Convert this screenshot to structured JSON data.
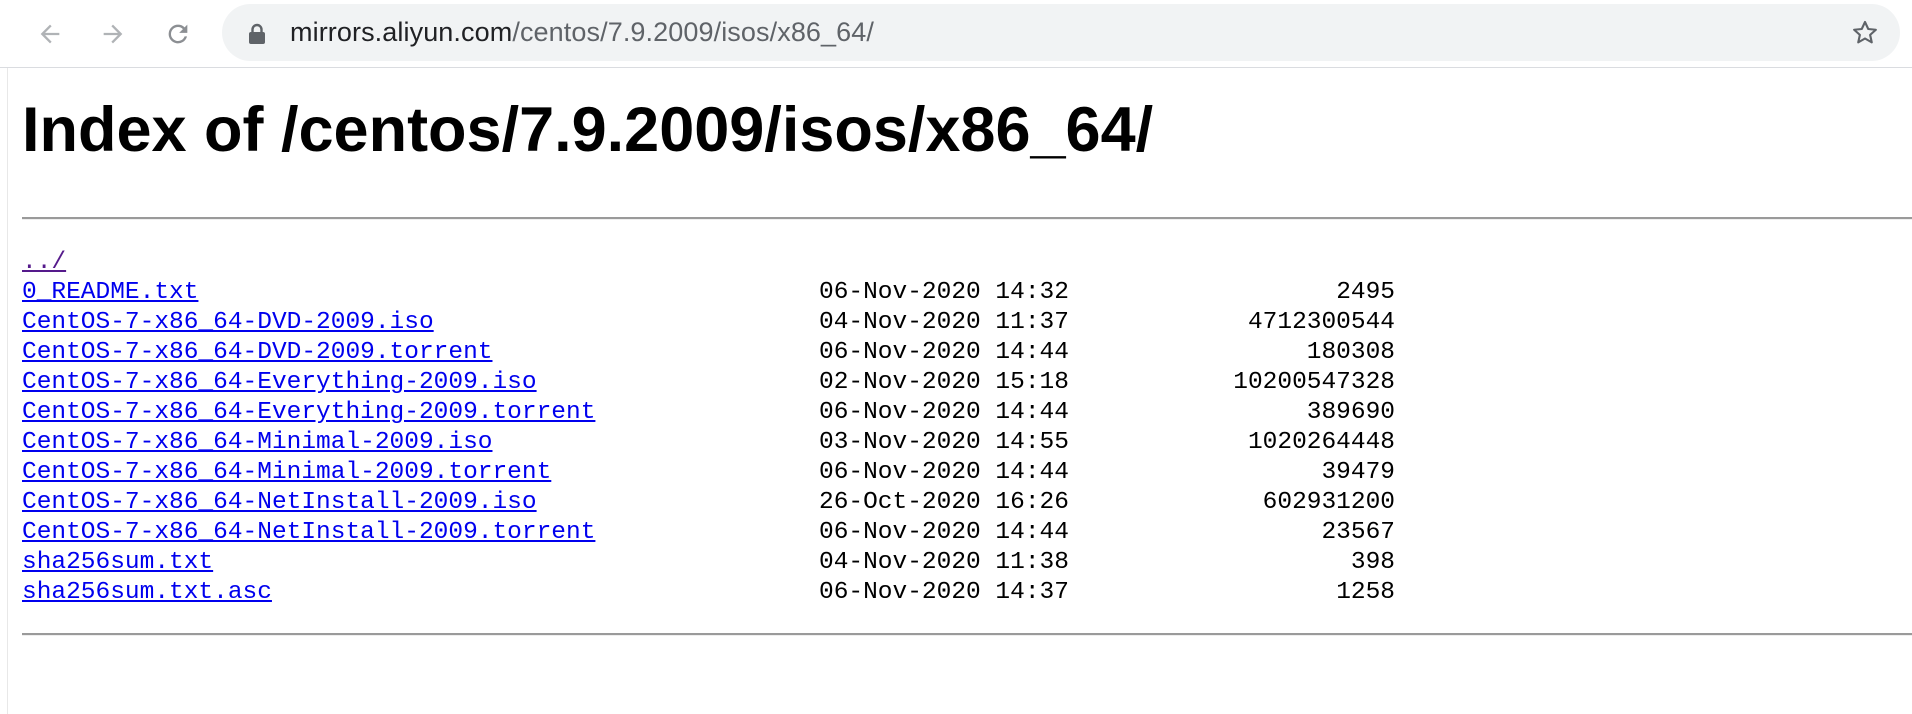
{
  "browser": {
    "url_host": "mirrors.aliyun.com",
    "url_path": "/centos/7.9.2009/isos/x86_64/",
    "icons": {
      "back": "back-arrow-icon",
      "forward": "forward-arrow-icon",
      "reload": "reload-icon",
      "lock": "lock-icon",
      "bookmark": "star-icon"
    }
  },
  "page": {
    "title": "Index of /centos/7.9.2009/isos/x86_64/",
    "parent_link": "../",
    "entries": [
      {
        "name": "0_README.txt",
        "date": "06-Nov-2020 14:32",
        "size": "2495"
      },
      {
        "name": "CentOS-7-x86_64-DVD-2009.iso",
        "date": "04-Nov-2020 11:37",
        "size": "4712300544"
      },
      {
        "name": "CentOS-7-x86_64-DVD-2009.torrent",
        "date": "06-Nov-2020 14:44",
        "size": "180308"
      },
      {
        "name": "CentOS-7-x86_64-Everything-2009.iso",
        "date": "02-Nov-2020 15:18",
        "size": "10200547328"
      },
      {
        "name": "CentOS-7-x86_64-Everything-2009.torrent",
        "date": "06-Nov-2020 14:44",
        "size": "389690"
      },
      {
        "name": "CentOS-7-x86_64-Minimal-2009.iso",
        "date": "03-Nov-2020 14:55",
        "size": "1020264448"
      },
      {
        "name": "CentOS-7-x86_64-Minimal-2009.torrent",
        "date": "06-Nov-2020 14:44",
        "size": "39479"
      },
      {
        "name": "CentOS-7-x86_64-NetInstall-2009.iso",
        "date": "26-Oct-2020 16:26",
        "size": "602931200"
      },
      {
        "name": "CentOS-7-x86_64-NetInstall-2009.torrent",
        "date": "06-Nov-2020 14:44",
        "size": "23567"
      },
      {
        "name": "sha256sum.txt",
        "date": "04-Nov-2020 11:38",
        "size": "398"
      },
      {
        "name": "sha256sum.txt.asc",
        "date": "06-Nov-2020 14:37",
        "size": "1258"
      }
    ]
  },
  "colors": {
    "link": "#0000ee",
    "visited_link": "#551a8b",
    "omnibox_bg": "#f1f3f4",
    "toolbar_icon": "#5f6368"
  }
}
